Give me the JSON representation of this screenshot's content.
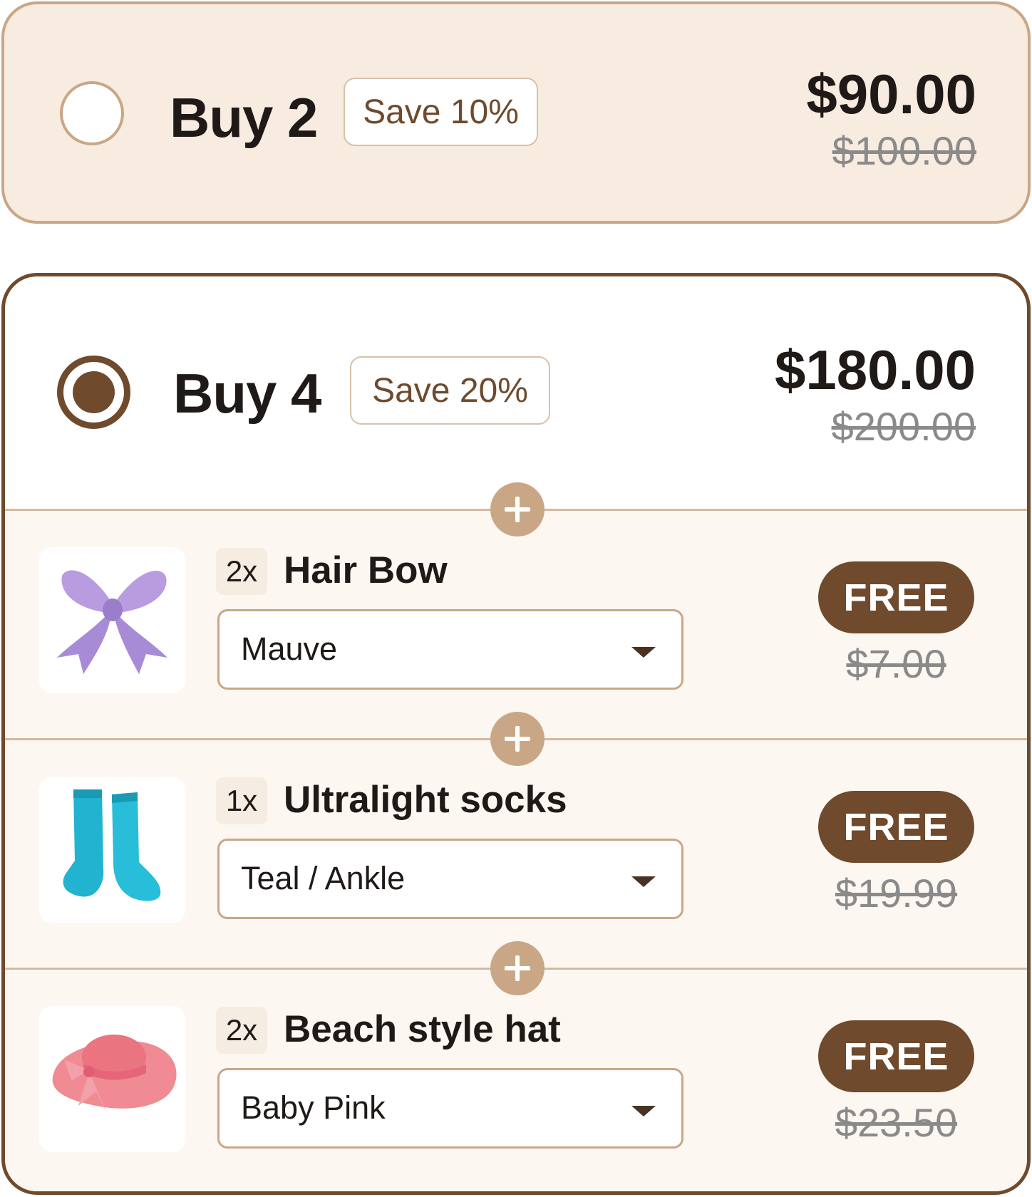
{
  "bundles": [
    {
      "title": "Buy 2",
      "badge": "Save 10%",
      "price": "$90.00",
      "compare_price": "$100.00",
      "selected": false
    },
    {
      "title": "Buy 4",
      "badge": "Save 20%",
      "price": "$180.00",
      "compare_price": "$200.00",
      "selected": true,
      "items": [
        {
          "qty": "2x",
          "name": "Hair Bow",
          "variant": "Mauve",
          "price_label": "FREE",
          "compare_price": "$7.00",
          "image_icon": "hair-bow-image"
        },
        {
          "qty": "1x",
          "name": "Ultralight socks",
          "variant": "Teal / Ankle",
          "price_label": "FREE",
          "compare_price": "$19.99",
          "image_icon": "socks-image"
        },
        {
          "qty": "2x",
          "name": "Beach style hat",
          "variant": "Baby Pink",
          "price_label": "FREE",
          "compare_price": "$23.50",
          "image_icon": "beach-hat-image"
        }
      ]
    }
  ],
  "colors": {
    "accent_brown": "#6f4a2c",
    "tan": "#c9a786",
    "card_bg": "#f8ebe0",
    "item_bg": "#fdf7f2"
  },
  "icons": {
    "add_separator": "plus-icon",
    "dropdown": "caret-down-icon"
  }
}
